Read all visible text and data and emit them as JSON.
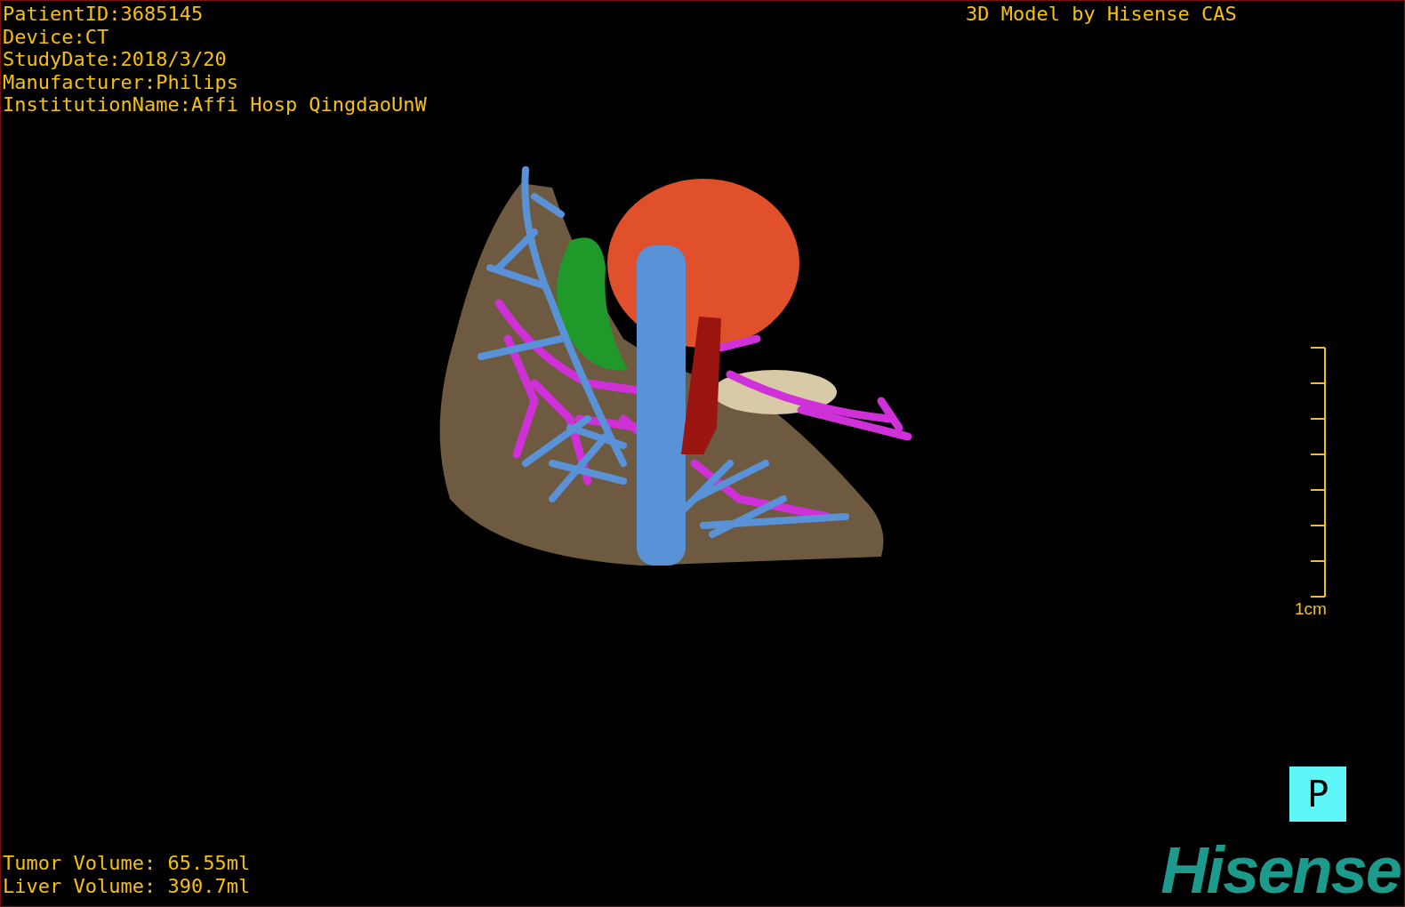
{
  "study_info": [
    "PatientID:3685145",
    "Device:CT",
    "StudyDate:2018/3/20",
    "Manufacturer:Philips",
    "InstitutionName:Affi Hosp QingdaoUnW"
  ],
  "header_right": "3D Model by Hisense CAS",
  "scale_bar": {
    "label": "1cm"
  },
  "orientation_button": "P",
  "volumes": [
    "Tumor Volume: 65.55ml",
    "Liver Volume: 390.7ml"
  ],
  "logo": "Hisense"
}
